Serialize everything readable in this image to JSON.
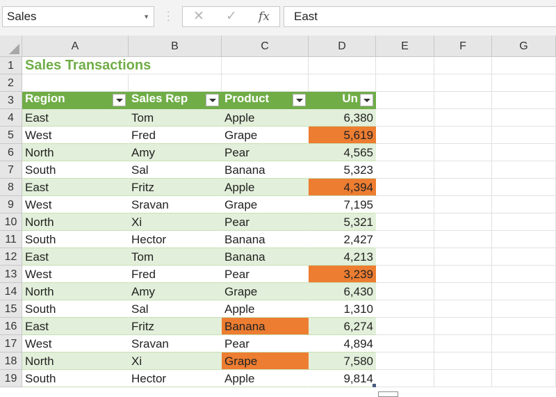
{
  "name_box": "Sales",
  "formula_value": "East",
  "columns": [
    "A",
    "B",
    "C",
    "D",
    "E",
    "F",
    "G"
  ],
  "rows": [
    "1",
    "2",
    "3",
    "4",
    "5",
    "6",
    "7",
    "8",
    "9",
    "10",
    "11",
    "12",
    "13",
    "14",
    "15",
    "16",
    "17",
    "18",
    "19"
  ],
  "title": "Sales Transactions",
  "headers": [
    "Region",
    "Sales Rep",
    "Product",
    "Units"
  ],
  "table_header_visible_text": "Un",
  "records": [
    {
      "region": "East",
      "rep": "Tom",
      "product": "Apple",
      "units": "6,380"
    },
    {
      "region": "West",
      "rep": "Fred",
      "product": "Grape",
      "units": "5,619"
    },
    {
      "region": "North",
      "rep": "Amy",
      "product": "Pear",
      "units": "4,565"
    },
    {
      "region": "South",
      "rep": "Sal",
      "product": "Banana",
      "units": "5,323"
    },
    {
      "region": "East",
      "rep": "Fritz",
      "product": "Apple",
      "units": "4,394"
    },
    {
      "region": "West",
      "rep": "Sravan",
      "product": "Grape",
      "units": "7,195"
    },
    {
      "region": "North",
      "rep": "Xi",
      "product": "Pear",
      "units": "5,321"
    },
    {
      "region": "South",
      "rep": "Hector",
      "product": "Banana",
      "units": "2,427"
    },
    {
      "region": "East",
      "rep": "Tom",
      "product": "Banana",
      "units": "4,213"
    },
    {
      "region": "West",
      "rep": "Fred",
      "product": "Pear",
      "units": "3,239"
    },
    {
      "region": "North",
      "rep": "Amy",
      "product": "Grape",
      "units": "6,430"
    },
    {
      "region": "South",
      "rep": "Sal",
      "product": "Apple",
      "units": "1,310"
    },
    {
      "region": "East",
      "rep": "Fritz",
      "product": "Banana",
      "units": "6,274"
    },
    {
      "region": "West",
      "rep": "Sravan",
      "product": "Pear",
      "units": "4,894"
    },
    {
      "region": "North",
      "rep": "Xi",
      "product": "Grape",
      "units": "7,580"
    },
    {
      "region": "South",
      "rep": "Hector",
      "product": "Apple",
      "units": "9,814"
    }
  ],
  "highlighted_units_rows": [
    1,
    4,
    9
  ],
  "highlighted_product_rows": [
    12,
    14
  ],
  "colors": {
    "header_green": "#70ad47",
    "band_green": "#e2efda",
    "highlight_orange": "#ed7d31",
    "title_green": "#70ad47"
  }
}
